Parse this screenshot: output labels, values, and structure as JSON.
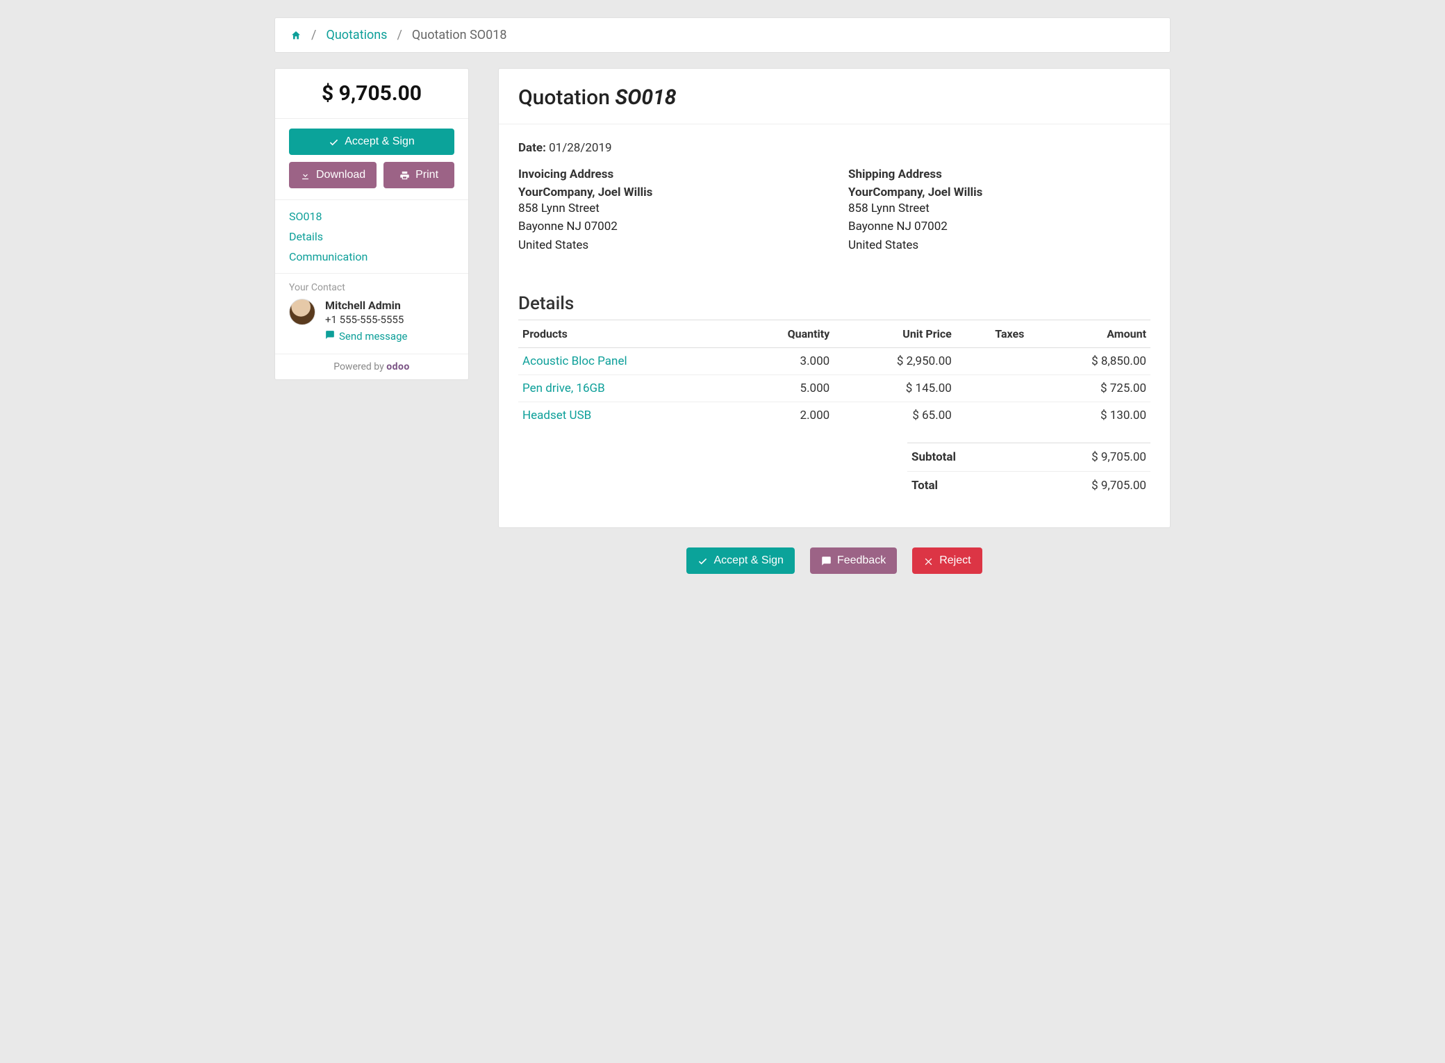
{
  "breadcrumb": {
    "quotations": "Quotations",
    "current": "Quotation SO018"
  },
  "sidebar": {
    "price": "$ 9,705.00",
    "accept_sign": "Accept & Sign",
    "download": "Download",
    "print": "Print",
    "nav": {
      "so": "SO018",
      "details": "Details",
      "communication": "Communication"
    },
    "contact": {
      "label": "Your Contact",
      "name": "Mitchell Admin",
      "phone": "+1 555-555-5555",
      "send_message": "Send message"
    },
    "powered_by": "Powered by",
    "powered_brand": "odoo"
  },
  "content": {
    "title_prefix": "Quotation ",
    "title_so": "SO018",
    "date_label": "Date:",
    "date_value": "01/28/2019",
    "invoicing": {
      "title": "Invoicing Address",
      "name": "YourCompany, Joel Willis",
      "street": "858 Lynn Street",
      "city": "Bayonne NJ 07002",
      "country": "United States"
    },
    "shipping": {
      "title": "Shipping Address",
      "name": "YourCompany, Joel Willis",
      "street": "858 Lynn Street",
      "city": "Bayonne NJ 07002",
      "country": "United States"
    },
    "details_heading": "Details",
    "columns": {
      "products": "Products",
      "quantity": "Quantity",
      "unit_price": "Unit Price",
      "taxes": "Taxes",
      "amount": "Amount"
    },
    "lines": [
      {
        "product": "Acoustic Bloc Panel",
        "qty": "3.000",
        "price": "$ 2,950.00",
        "taxes": "",
        "amount": "$ 8,850.00"
      },
      {
        "product": "Pen drive, 16GB",
        "qty": "5.000",
        "price": "$ 145.00",
        "taxes": "",
        "amount": "$ 725.00"
      },
      {
        "product": "Headset USB",
        "qty": "2.000",
        "price": "$ 65.00",
        "taxes": "",
        "amount": "$ 130.00"
      }
    ],
    "subtotal_label": "Subtotal",
    "subtotal_value": "$ 9,705.00",
    "total_label": "Total",
    "total_value": "$ 9,705.00"
  },
  "bottom": {
    "accept_sign": "Accept & Sign",
    "feedback": "Feedback",
    "reject": "Reject"
  }
}
